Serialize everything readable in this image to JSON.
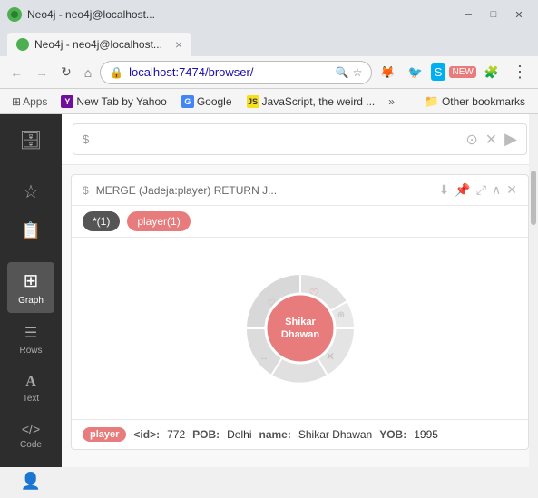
{
  "titlebar": {
    "title": "Neo4j - neo4j@localhost...",
    "controls": {
      "minimize": "─",
      "maximize": "□",
      "close": "✕"
    }
  },
  "tab": {
    "title": "Neo4j - neo4j@localhost...",
    "close": "×"
  },
  "navbar": {
    "back": "←",
    "forward": "→",
    "reload": "↻",
    "home": "⌂",
    "address": "localhost:7474/browser/",
    "menu": "⋮"
  },
  "bookmarks": {
    "apps_label": "Apps",
    "items": [
      {
        "label": "New Tab by Yahoo",
        "icon": "Y",
        "type": "yahoo"
      },
      {
        "label": "Google",
        "icon": "G",
        "type": "google"
      },
      {
        "label": "JavaScript, the weird ...",
        "icon": "JS",
        "type": "js"
      }
    ],
    "more": "»",
    "other_label": "Other bookmarks"
  },
  "sidebar": {
    "items": [
      {
        "icon": "🗄",
        "label": ""
      },
      {
        "icon": "☆",
        "label": ""
      },
      {
        "icon": "📄",
        "label": ""
      },
      {
        "icon": "⊞",
        "label": "Graph"
      },
      {
        "icon": "A",
        "label": "Rows"
      },
      {
        "icon": "⟨/⟩",
        "label": "Text"
      },
      {
        "icon": "{ }",
        "label": "Code"
      }
    ]
  },
  "query": {
    "prompt": "$",
    "placeholder": "$",
    "actions": [
      "⭕",
      "✕",
      "▶"
    ]
  },
  "result": {
    "prompt": "$",
    "query_text": "MERGE (Jadeja:player) RETURN J...",
    "actions": [
      "⬇",
      "📌",
      "⤢",
      "∧",
      "✕"
    ],
    "tabs": [
      {
        "label": "*(1)",
        "type": "nodes"
      },
      {
        "label": "player(1)",
        "type": "player"
      }
    ],
    "graph": {
      "center_node": "Shikar\nDhawan",
      "center_color": "#e87c7c"
    },
    "info_bar": {
      "badge": "player",
      "fields": [
        {
          "label": "<id>:",
          "value": "772"
        },
        {
          "label": "POB:",
          "value": "Delhi"
        },
        {
          "label": "name:",
          "value": "Shikar Dhawan"
        },
        {
          "label": "YOB:",
          "value": "1995"
        }
      ]
    }
  }
}
